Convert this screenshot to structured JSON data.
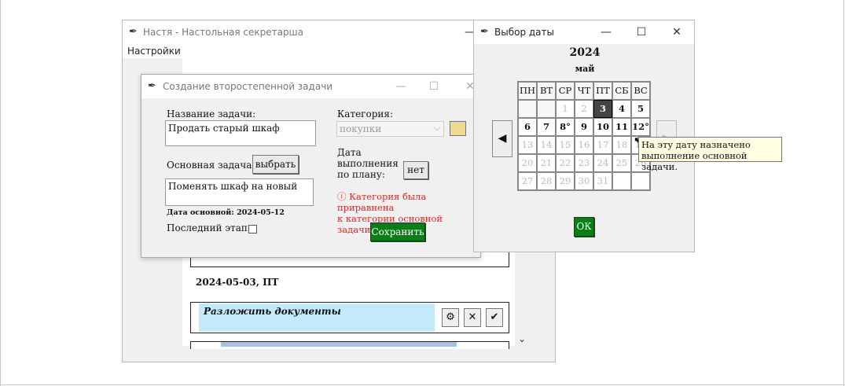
{
  "main_window": {
    "title": "Настя - Настольная секретарша",
    "menu": "Настройки",
    "date_header": "2024-05-03, ПТ",
    "task_title": "Разложить документы",
    "task_buttons": {
      "settings": "⚙",
      "delete": "✕",
      "done": "✔"
    },
    "scroll_icon": "chevron-down-icon"
  },
  "dialog": {
    "title": "Создание второстепенной задачи",
    "task_name_label": "Название задачи:",
    "task_name_value": "Продать старый шкаф",
    "main_task_label": "Основная задача:",
    "choose_button": "выбрать",
    "main_task_value": "Поменять шкаф на новый",
    "main_date": "Дата основной: 2024-05-12",
    "last_stage_label": "Последний этап:",
    "category_label": "Категория:",
    "category_value": "покупки",
    "category_color": "#f1da8e",
    "due_label_1": "Дата",
    "due_label_2": "выполнения",
    "due_label_3": "по плану:",
    "due_button": "нет",
    "warning_line1": "ⓘ Категория была приравнена",
    "warning_line2": "к категории основной задачи.",
    "save_button": "Сохранить",
    "accent_green": "#0a7d17"
  },
  "datepicker": {
    "title": "Выбор даты",
    "year": "2024",
    "month": "май",
    "weekdays": [
      "ПН",
      "ВТ",
      "СР",
      "ЧТ",
      "ПТ",
      "СБ",
      "ВС"
    ],
    "prev_button": "◀",
    "ok_button": "ОК",
    "tooltip_line1": "На эту дату назначено",
    "tooltip_line2": "выполнение основной задачи.",
    "days_row1": [
      "",
      "",
      "1",
      "2",
      "3",
      "4",
      "5"
    ],
    "days_row2": [
      "6",
      "7",
      "8°",
      "9",
      "10",
      "11",
      "12°"
    ],
    "days_row3": [
      "13",
      "14",
      "15",
      "16",
      "17",
      "18",
      "19"
    ],
    "days_row4": [
      "20",
      "21",
      "22",
      "23",
      "24",
      "25",
      "26"
    ],
    "days_row5": [
      "27",
      "28",
      "29",
      "30",
      "31",
      "",
      ""
    ]
  },
  "window_controls": {
    "minimize": "—",
    "maximize": "☐",
    "close": "✕"
  }
}
